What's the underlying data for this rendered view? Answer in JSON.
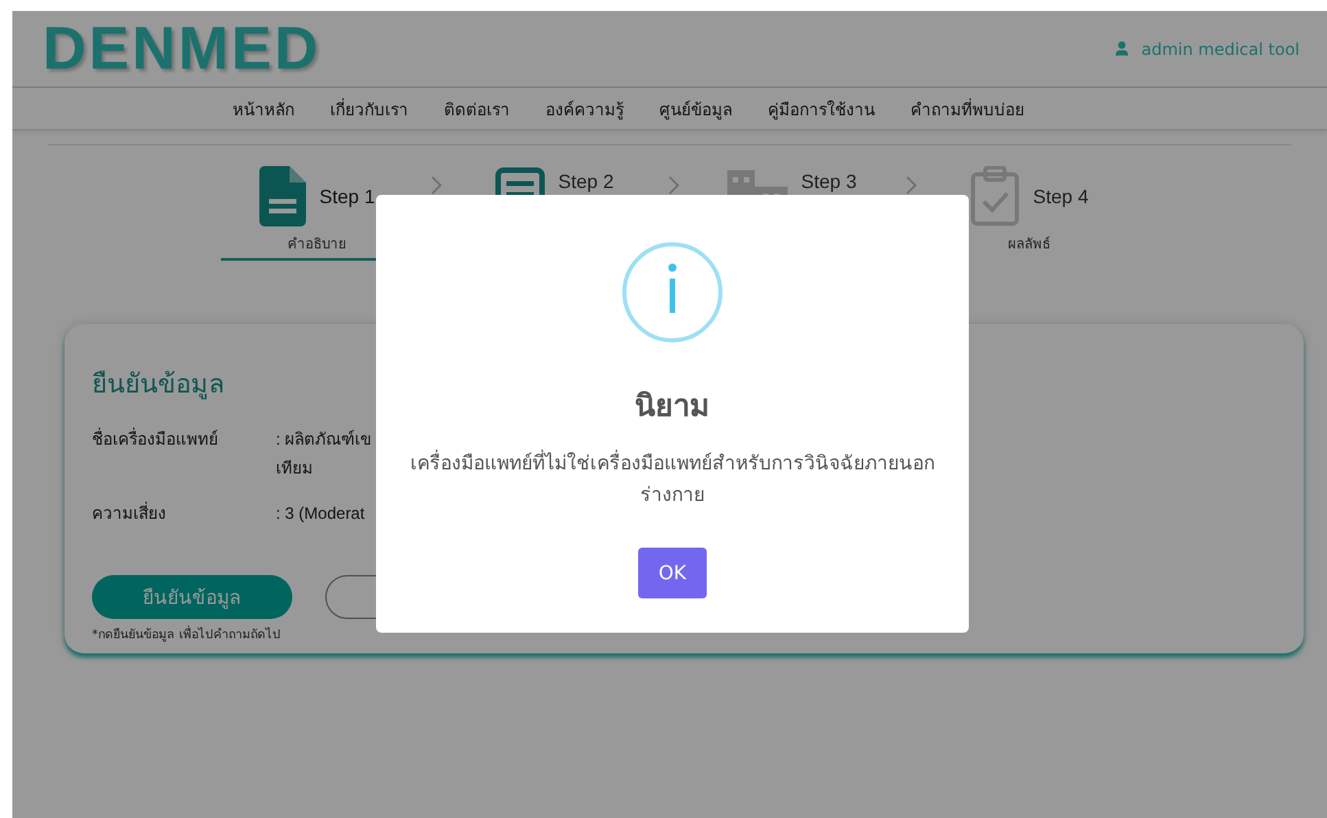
{
  "header": {
    "logo": "DENMED",
    "user": "admin medical tool"
  },
  "nav": [
    "หน้าหลัก",
    "เกี่ยวกับเรา",
    "ติดต่อเรา",
    "องค์ความรู้",
    "ศูนย์ข้อมูล",
    "คู่มือการใช้งาน",
    "คำถามที่พบบ่อย"
  ],
  "steps": [
    {
      "label": "Step 1",
      "caption": "คำอธิบาย",
      "selected": true,
      "enabled": true
    },
    {
      "label": "Step 2",
      "selected": false,
      "enabled": true
    },
    {
      "label": "Step 3",
      "selected": false,
      "enabled": false
    },
    {
      "label": "Step 4",
      "caption": "ผลลัพธ์",
      "selected": false,
      "enabled": false
    }
  ],
  "card": {
    "title": "ยืนยันข้อมูล",
    "fields": [
      {
        "label": "ชื่อเครื่องมือแพทย์",
        "value_lines": [
          ": ผลิตภัณฑ์เข",
          "เทียม"
        ]
      },
      {
        "label": "ความเสี่ยง",
        "value_lines": [
          ": 3 (Moderat"
        ]
      }
    ],
    "confirm_button": "ยืนยันข้อมูล",
    "note": "*กดยืนยันข้อมูล เพื่อไปคำถามถัดไป"
  },
  "dialog": {
    "title": "นิยาม",
    "message": "เครื่องมือแพทย์ที่ไม่ใช่เครื่องมือแพทย์สำหรับการวินิจฉัยภายนอกร่างกาย",
    "button": "OK"
  }
}
